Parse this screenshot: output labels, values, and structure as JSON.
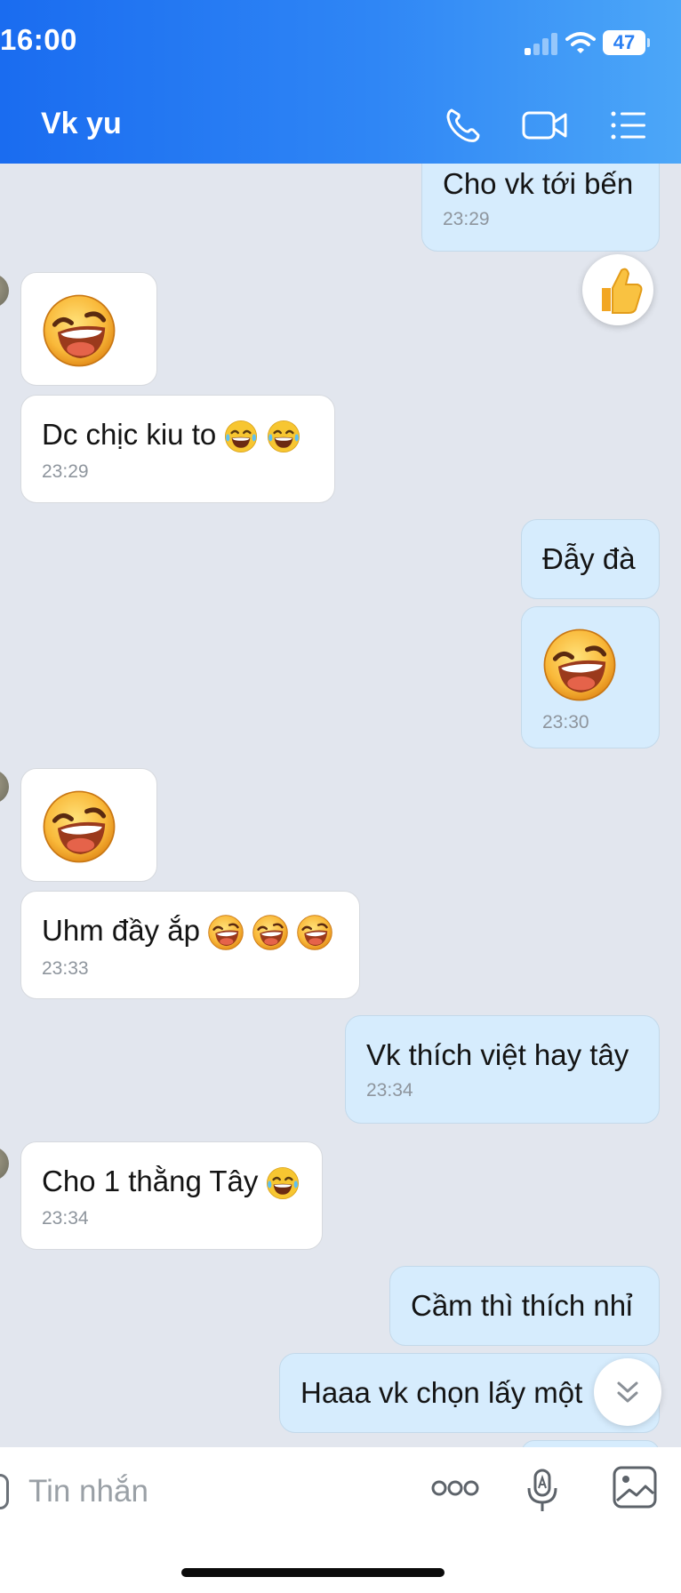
{
  "status_bar": {
    "time": "16:00",
    "battery": "47"
  },
  "header": {
    "title": "Vk yu"
  },
  "messages": [
    {
      "text": "Cho vk tới bến",
      "time": "23:29"
    },
    {
      "text": "Dc chịc kiu to",
      "time": "23:29"
    },
    {
      "text": "Đẫy đà"
    },
    {
      "time": "23:30"
    },
    {
      "text": "Uhm đầy ắp",
      "time": "23:33"
    },
    {
      "text": "Vk thích việt hay tây",
      "time": "23:34"
    },
    {
      "text": "Cho 1 thằng Tây",
      "time": "23:34"
    },
    {
      "text": "Cầm thì thích nhỉ"
    },
    {
      "text": "Haaa vk chọn lấy một"
    }
  ],
  "input": {
    "placeholder": "Tin nhắn"
  },
  "colors": {
    "header_start": "#1a6cf0",
    "header_end": "#4ca7f8",
    "chat_bg": "#e2e6ee",
    "outgoing_bubble": "#d6ecfd",
    "incoming_bubble": "#ffffff"
  },
  "icons": [
    "back-icon",
    "phone-icon",
    "video-call-icon",
    "list-menu-icon",
    "thumbs-up-icon",
    "chevron-down-double-icon",
    "sticker-icon",
    "more-icon",
    "voice-to-text-icon",
    "image-gallery-icon"
  ]
}
